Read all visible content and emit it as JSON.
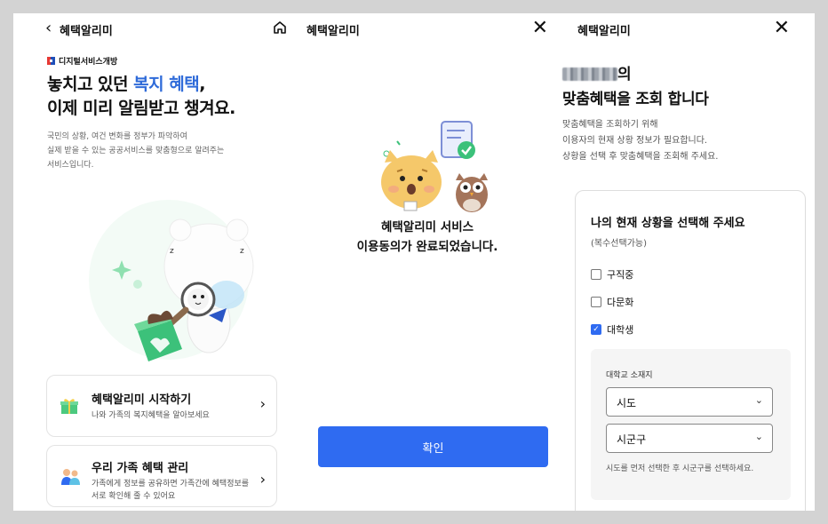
{
  "panel1": {
    "header_title": "혜택알리미",
    "brand": "디지털서비스개방",
    "hero_line1_pre": "놓치고 있던 ",
    "hero_line1_highlight": "복지 혜택",
    "hero_line1_post": ",",
    "hero_line2": "이제 미리 알림받고 챙겨요.",
    "sub_lines": [
      "국민의 상황, 여건 변화를 정부가 파악하여",
      "실제 받을 수 있는 공공서비스를 맞춤형으로 알려주는",
      "서비스입니다."
    ],
    "cards": [
      {
        "title": "혜택알리미 시작하기",
        "desc": "나와 가족의 복지혜택을 알아보세요"
      },
      {
        "title": "우리 가족 혜택 관리",
        "desc": "가족에게 정보를 공유하면 가족간에 혜택정보를 서로 확인해 줄 수 있어요"
      }
    ]
  },
  "panel2": {
    "header_title": "혜택알리미",
    "message_line1": "혜택알리미 서비스",
    "message_line2": "이용동의가 완료되었습니다.",
    "confirm_label": "확인"
  },
  "panel3": {
    "header_title": "혜택알리미",
    "hero_name_suffix": "의",
    "hero_line2": "맞춤혜택을 조회 합니다",
    "sub_lines": [
      "맞춤혜택을 조회하기 위해",
      "이용자의 현재 상황 정보가 필요합니다.",
      "상황을 선택 후 맞춤혜택을 조회해 주세요."
    ],
    "question": "나의 현재 상황을 선택해 주세요",
    "hint": "(복수선택가능)",
    "options": [
      {
        "label": "구직중",
        "checked": false
      },
      {
        "label": "다문화",
        "checked": false
      },
      {
        "label": "대학생",
        "checked": true
      }
    ],
    "university_location_label": "대학교 소재지",
    "select_sido": "시도",
    "select_sigungu": "시군구",
    "note": "시도를 먼저 선택한 후 시군구를 선택하세요."
  },
  "colors": {
    "accent": "#2f6bf1",
    "highlight_text": "#2f6bd9"
  }
}
